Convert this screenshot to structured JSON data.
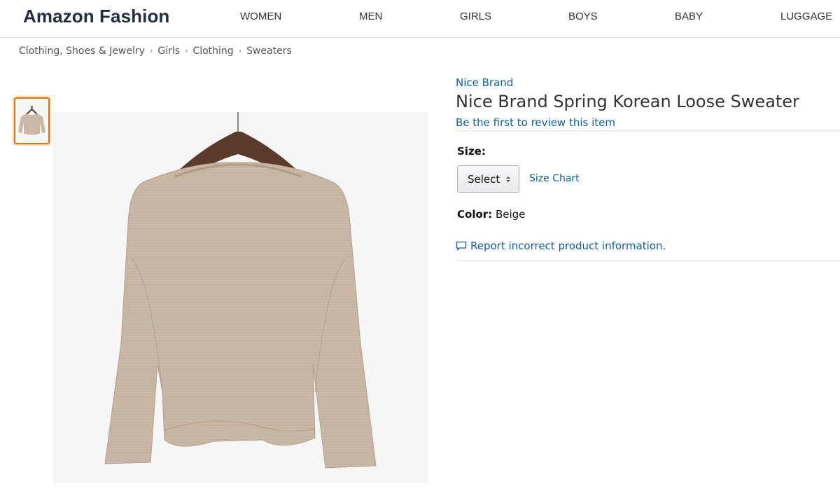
{
  "header": {
    "logo": "Amazon Fashion",
    "nav": [
      "WOMEN",
      "MEN",
      "GIRLS",
      "BOYS",
      "BABY",
      "LUGGAGE"
    ]
  },
  "breadcrumb": [
    "Clothing, Shoes & Jewelry",
    "Girls",
    "Clothing",
    "Sweaters"
  ],
  "product": {
    "brand": "Nice Brand",
    "title": "Nice Brand Spring Korean Loose Sweater",
    "review_link": "Be the first to review this item",
    "size_label": "Size:",
    "size_select_value": "Select",
    "size_chart_link": "Size Chart",
    "color_label": "Color:",
    "color_value": "Beige",
    "report_link": "Report incorrect product information."
  },
  "colors": {
    "link": "#0f5ea7",
    "thumb_border": "#e77600",
    "sweater": "#c9b8a6",
    "hanger": "#5a3a28"
  },
  "icons": {
    "report": "speech-bubble-icon",
    "select": "up-down-arrows-icon"
  }
}
